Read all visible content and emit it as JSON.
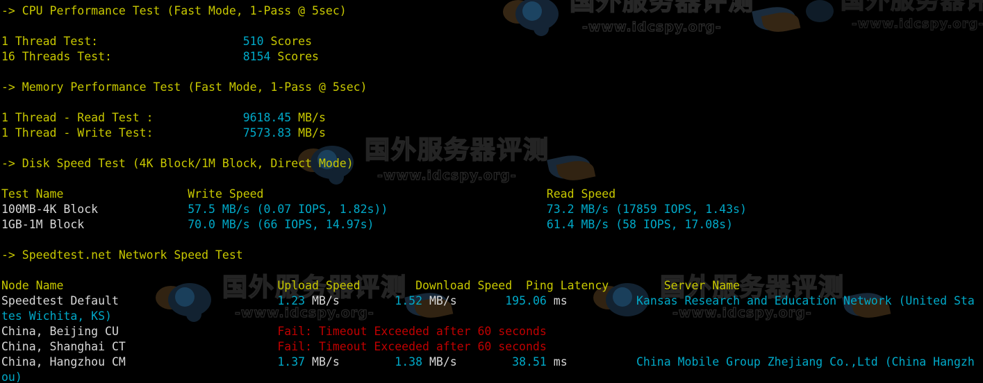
{
  "terminal": {
    "background": "#000000",
    "colors": {
      "heading": "#c8c800",
      "value": "#00a9c8",
      "label": "#d8d8d8",
      "error": "#c00000"
    },
    "watermark": {
      "chinese_text": "国外服务器评测",
      "url_text": "-www.idcspy.org-"
    },
    "lines": [
      {
        "id": "cpu-heading",
        "segments": [
          {
            "text": "-> CPU Performance Test (Fast Mode, 1-Pass @ 5sec)",
            "color": "yellow"
          }
        ]
      },
      {
        "id": "blank-1",
        "segments": [
          {
            "text": " ",
            "color": "blank"
          }
        ]
      },
      {
        "id": "cpu-1thread",
        "segments": [
          {
            "text": "1 Thread Test:",
            "color": "yellow"
          },
          {
            "text": "                     ",
            "color": "blank"
          },
          {
            "text": "510",
            "color": "cyan"
          },
          {
            "text": " Scores",
            "color": "yellow"
          }
        ]
      },
      {
        "id": "cpu-16threads",
        "segments": [
          {
            "text": "16 Threads Test:",
            "color": "yellow"
          },
          {
            "text": "                   ",
            "color": "blank"
          },
          {
            "text": "8154",
            "color": "cyan"
          },
          {
            "text": " Scores",
            "color": "yellow"
          }
        ]
      },
      {
        "id": "blank-2",
        "segments": [
          {
            "text": " ",
            "color": "blank"
          }
        ]
      },
      {
        "id": "memory-heading",
        "segments": [
          {
            "text": "-> Memory Performance Test (Fast Mode, 1-Pass @ 5sec)",
            "color": "yellow"
          }
        ]
      },
      {
        "id": "blank-3",
        "segments": [
          {
            "text": " ",
            "color": "blank"
          }
        ]
      },
      {
        "id": "mem-read",
        "segments": [
          {
            "text": "1 Thread - Read Test :",
            "color": "yellow"
          },
          {
            "text": "             ",
            "color": "blank"
          },
          {
            "text": "9618.45",
            "color": "cyan"
          },
          {
            "text": " MB/s",
            "color": "yellow"
          }
        ]
      },
      {
        "id": "mem-write",
        "segments": [
          {
            "text": "1 Thread - Write Test:",
            "color": "yellow"
          },
          {
            "text": "             ",
            "color": "blank"
          },
          {
            "text": "7573.83",
            "color": "cyan"
          },
          {
            "text": " MB/s",
            "color": "yellow"
          }
        ]
      },
      {
        "id": "blank-4",
        "segments": [
          {
            "text": " ",
            "color": "blank"
          }
        ]
      },
      {
        "id": "disk-heading",
        "segments": [
          {
            "text": "-> Disk Speed Test (4K Block/1M Block, Direct Mode)",
            "color": "yellow"
          }
        ]
      },
      {
        "id": "blank-5",
        "segments": [
          {
            "text": " ",
            "color": "blank"
          }
        ]
      },
      {
        "id": "disk-header-row",
        "segments": [
          {
            "text": "Test Name",
            "color": "yellow"
          },
          {
            "text": "                  ",
            "color": "blank"
          },
          {
            "text": "Write Speed",
            "color": "yellow"
          },
          {
            "text": "                                         ",
            "color": "blank"
          },
          {
            "text": "Read Speed",
            "color": "yellow"
          }
        ]
      },
      {
        "id": "disk-4k-row",
        "segments": [
          {
            "text": "100MB-4K Block",
            "color": "white"
          },
          {
            "text": "             ",
            "color": "blank"
          },
          {
            "text": "57.5 MB/s (0.07 IOPS, 1.82s))",
            "color": "cyan"
          },
          {
            "text": "                       ",
            "color": "blank"
          },
          {
            "text": "73.2 MB/s (17859 IOPS, 1.43s)",
            "color": "cyan"
          }
        ]
      },
      {
        "id": "disk-1m-row",
        "segments": [
          {
            "text": "1GB-1M Block",
            "color": "white"
          },
          {
            "text": "               ",
            "color": "blank"
          },
          {
            "text": "70.0 MB/s (66 IOPS, 14.97s)",
            "color": "cyan"
          },
          {
            "text": "                         ",
            "color": "blank"
          },
          {
            "text": "61.4 MB/s (58 IOPS, 17.08s)",
            "color": "cyan"
          }
        ]
      },
      {
        "id": "blank-6",
        "segments": [
          {
            "text": " ",
            "color": "blank"
          }
        ]
      },
      {
        "id": "speedtest-heading",
        "segments": [
          {
            "text": "-> Speedtest.net Network Speed Test",
            "color": "yellow"
          }
        ]
      },
      {
        "id": "blank-7",
        "segments": [
          {
            "text": " ",
            "color": "blank"
          }
        ]
      },
      {
        "id": "net-header-row",
        "segments": [
          {
            "text": "Node Name",
            "color": "yellow"
          },
          {
            "text": "                               ",
            "color": "blank"
          },
          {
            "text": "Upload Speed",
            "color": "yellow"
          },
          {
            "text": "        ",
            "color": "blank"
          },
          {
            "text": "Download Speed",
            "color": "yellow"
          },
          {
            "text": "  ",
            "color": "blank"
          },
          {
            "text": "Ping Latency",
            "color": "yellow"
          },
          {
            "text": "        ",
            "color": "blank"
          },
          {
            "text": "Server Name",
            "color": "yellow"
          }
        ]
      },
      {
        "id": "net-row-default",
        "segments": [
          {
            "text": "Speedtest Default",
            "color": "white"
          },
          {
            "text": "                       ",
            "color": "blank"
          },
          {
            "text": "1.23",
            "color": "cyan"
          },
          {
            "text": " MB/s",
            "color": "white"
          },
          {
            "text": "        ",
            "color": "blank"
          },
          {
            "text": "1.52",
            "color": "cyan"
          },
          {
            "text": " MB/s",
            "color": "white"
          },
          {
            "text": "       ",
            "color": "blank"
          },
          {
            "text": "195.06",
            "color": "cyan"
          },
          {
            "text": " ms",
            "color": "white"
          },
          {
            "text": "          ",
            "color": "blank"
          },
          {
            "text": "Kansas Research and Education Network (United Sta",
            "color": "cyan"
          }
        ]
      },
      {
        "id": "net-row-default-wrap",
        "segments": [
          {
            "text": "tes Wichita, KS)",
            "color": "cyan"
          }
        ]
      },
      {
        "id": "net-row-beijing-cu",
        "segments": [
          {
            "text": "China, Beijing CU",
            "color": "white"
          },
          {
            "text": "                       ",
            "color": "blank"
          },
          {
            "text": "Fail: Timeout Exceeded after 60 seconds",
            "color": "red"
          }
        ]
      },
      {
        "id": "net-row-shanghai-ct",
        "segments": [
          {
            "text": "China, Shanghai CT",
            "color": "white"
          },
          {
            "text": "                      ",
            "color": "blank"
          },
          {
            "text": "Fail: Timeout Exceeded after 60 seconds",
            "color": "red"
          }
        ]
      },
      {
        "id": "net-row-hangzhou-cm",
        "segments": [
          {
            "text": "China, Hangzhou CM",
            "color": "white"
          },
          {
            "text": "                      ",
            "color": "blank"
          },
          {
            "text": "1.37",
            "color": "cyan"
          },
          {
            "text": " MB/s",
            "color": "white"
          },
          {
            "text": "        ",
            "color": "blank"
          },
          {
            "text": "1.38",
            "color": "cyan"
          },
          {
            "text": " MB/s",
            "color": "white"
          },
          {
            "text": "        ",
            "color": "blank"
          },
          {
            "text": "38.51",
            "color": "cyan"
          },
          {
            "text": " ms",
            "color": "white"
          },
          {
            "text": "          ",
            "color": "blank"
          },
          {
            "text": "China Mobile Group Zhejiang Co.,Ltd (China Hangzh",
            "color": "cyan"
          }
        ]
      },
      {
        "id": "net-row-hangzhou-cm-wrap",
        "segments": [
          {
            "text": "ou)",
            "color": "cyan"
          }
        ]
      }
    ]
  }
}
